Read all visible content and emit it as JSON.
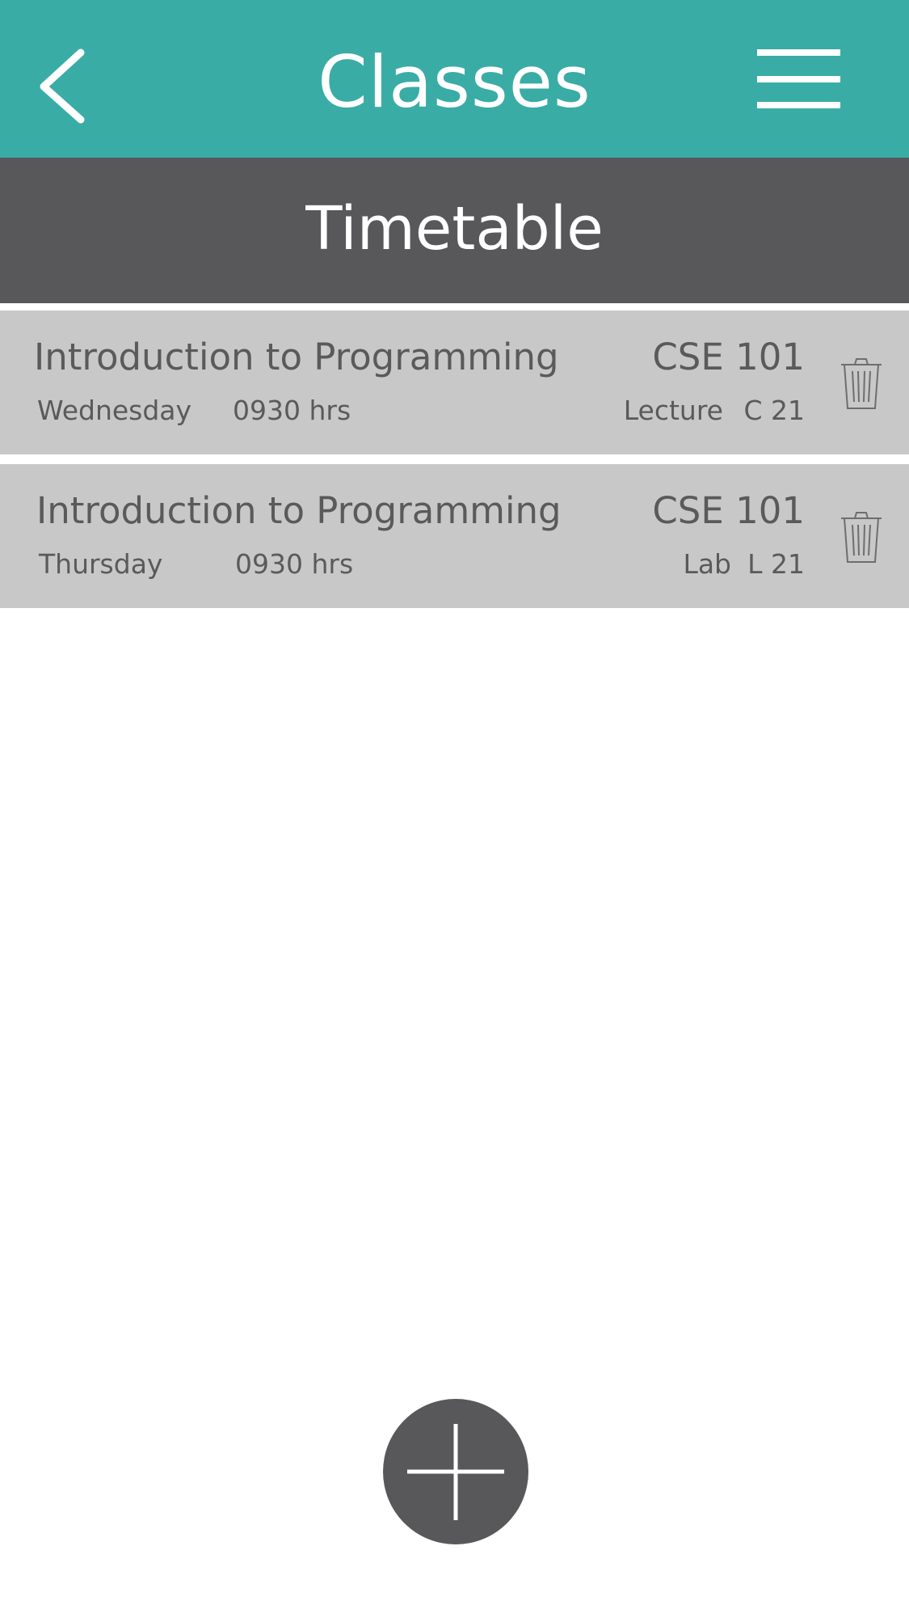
{
  "header": {
    "title": "Classes",
    "back_icon": "chevron-left-icon",
    "menu_icon": "hamburger-menu-icon",
    "background_color": "#3aaca6"
  },
  "subheader": {
    "title": "Timetable",
    "background_color": "#58585a"
  },
  "classes": [
    {
      "name": "Introduction to Programming",
      "code": "CSE 101",
      "day": "Wednesday",
      "time": "0930 hrs",
      "type": "Lecture",
      "room": "C 21",
      "action_icon": "trash-icon"
    },
    {
      "name": "Introduction to Programming",
      "code": "CSE 101",
      "day": "Thursday",
      "time": "0930 hrs",
      "type": "Lab",
      "room": "L 21",
      "action_icon": "trash-icon"
    }
  ],
  "fab": {
    "icon": "plus-icon",
    "background_color": "#58585a"
  }
}
